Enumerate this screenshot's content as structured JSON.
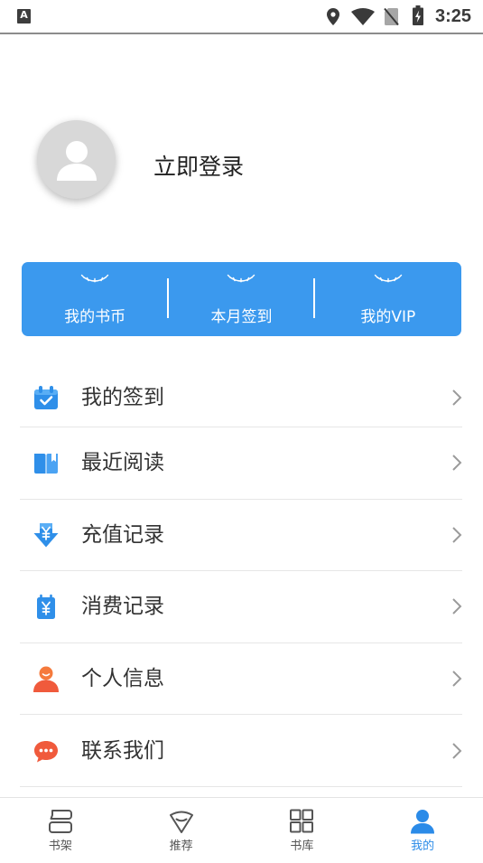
{
  "status_bar": {
    "notification_icon": "app-notification-icon",
    "notification_letter": "A",
    "icons": [
      "location-icon",
      "wifi-icon",
      "no-sim-icon",
      "battery-charging-icon"
    ],
    "time": "3:25"
  },
  "profile": {
    "avatar_icon": "default-avatar-icon",
    "login_label": "立即登录"
  },
  "stats_card": {
    "items": [
      {
        "icon": "closed-eye-icon",
        "label": "我的书币"
      },
      {
        "icon": "closed-eye-icon",
        "label": "本月签到"
      },
      {
        "icon": "closed-eye-icon",
        "label": "我的VIP"
      }
    ]
  },
  "menu": {
    "chevron_icon": "chevron-right-icon",
    "items": [
      {
        "icon": "calendar-check-icon",
        "label": "我的签到"
      },
      {
        "icon": "book-icon",
        "label": "最近阅读"
      },
      {
        "icon": "recharge-icon",
        "label": "充值记录"
      },
      {
        "icon": "consume-bag-icon",
        "label": "消费记录"
      },
      {
        "icon": "person-icon",
        "label": "个人信息"
      },
      {
        "icon": "chat-bubble-icon",
        "label": "联系我们"
      }
    ]
  },
  "bottom_nav": {
    "items": [
      {
        "icon": "bookshelf-icon",
        "label": "书架",
        "active": false
      },
      {
        "icon": "recommend-icon",
        "label": "推荐",
        "active": false
      },
      {
        "icon": "library-grid-icon",
        "label": "书库",
        "active": false
      },
      {
        "icon": "profile-icon",
        "label": "我的",
        "active": true
      }
    ]
  },
  "colors": {
    "card_blue": "#3b99ee",
    "icon_blue": "#2f8fe9",
    "icon_orange": "#f05a3c",
    "nav_active": "#2b8be8",
    "nav_inactive": "#555555"
  }
}
